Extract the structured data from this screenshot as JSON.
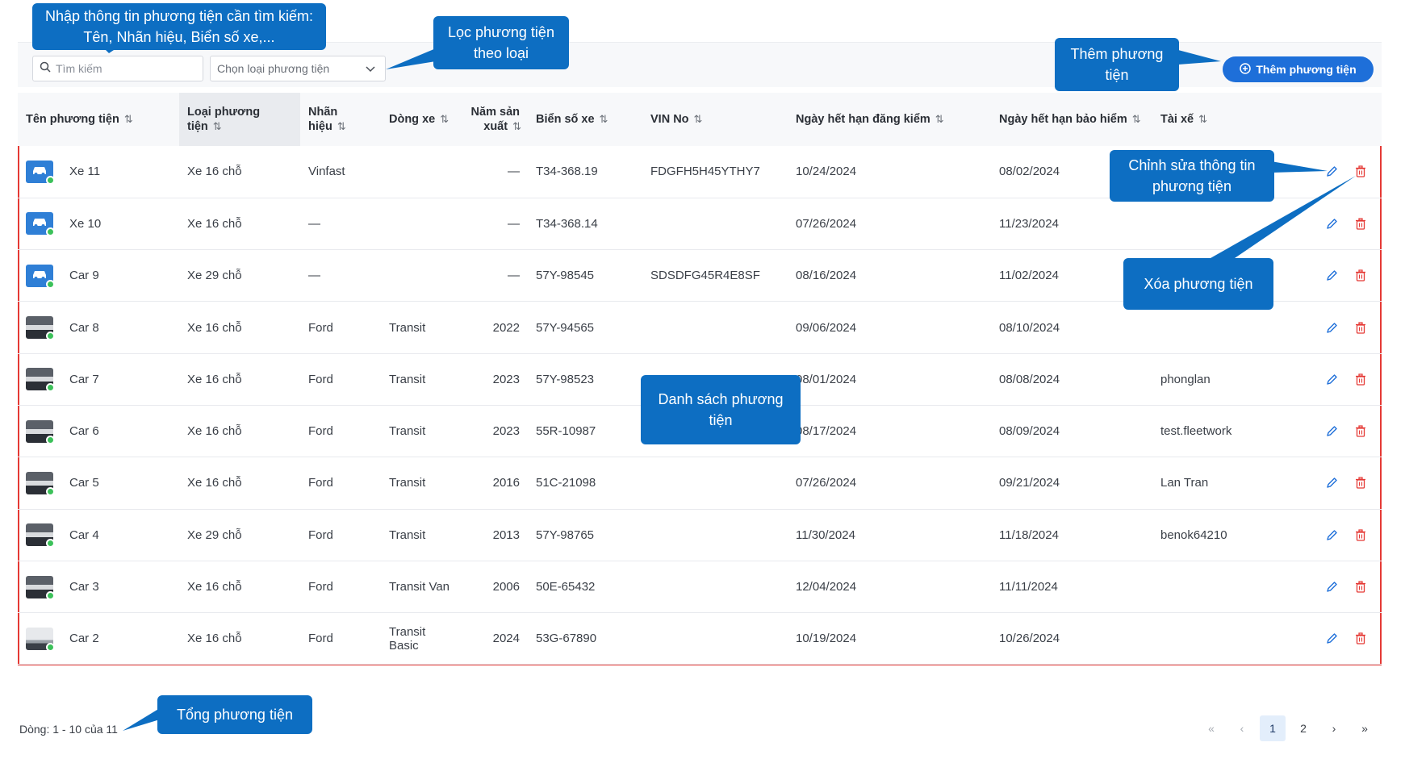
{
  "toolbar": {
    "search_placeholder": "Tìm kiếm",
    "type_select_placeholder": "Chọn loại phương tiện",
    "add_button_label": "Thêm phương tiện"
  },
  "table": {
    "columns": [
      {
        "label": "Tên phương tiện",
        "sortable": true
      },
      {
        "label": "Loại phương tiện",
        "sortable": true
      },
      {
        "label": "Nhãn hiệu",
        "sortable": true
      },
      {
        "label": "Dòng xe",
        "sortable": true
      },
      {
        "label": "Năm sản xuất",
        "sortable": true
      },
      {
        "label": "Biển số xe",
        "sortable": true
      },
      {
        "label": "VIN No",
        "sortable": true
      },
      {
        "label": "Ngày hết hạn đăng kiểm",
        "sortable": true
      },
      {
        "label": "Ngày hết hạn bảo hiểm",
        "sortable": true
      },
      {
        "label": "Tài xế",
        "sortable": true
      }
    ],
    "sort_icon": "⇅",
    "rows": [
      {
        "thumb": "blue-car",
        "name": "Xe 11",
        "type": "Xe 16 chỗ",
        "brand": "Vinfast",
        "model": "",
        "year": "—",
        "plate": "T34-368.19",
        "vin": "FDGFH5H45YTHY7",
        "inspection": "10/24/2024",
        "insurance": "08/02/2024",
        "driver": ""
      },
      {
        "thumb": "blue-car",
        "name": "Xe 10",
        "type": "Xe 16 chỗ",
        "brand": "—",
        "model": "",
        "year": "—",
        "plate": "T34-368.14",
        "vin": "",
        "inspection": "07/26/2024",
        "insurance": "11/23/2024",
        "driver": ""
      },
      {
        "thumb": "blue-car",
        "name": "Car 9",
        "type": "Xe 29 chỗ",
        "brand": "—",
        "model": "",
        "year": "—",
        "plate": "57Y-98545",
        "vin": "SDSDFG45R4E8SF",
        "inspection": "08/16/2024",
        "insurance": "11/02/2024",
        "driver": ""
      },
      {
        "thumb": "van",
        "name": "Car 8",
        "type": "Xe 16 chỗ",
        "brand": "Ford",
        "model": "Transit",
        "year": "2022",
        "plate": "57Y-94565",
        "vin": "",
        "inspection": "09/06/2024",
        "insurance": "08/10/2024",
        "driver": ""
      },
      {
        "thumb": "van",
        "name": "Car 7",
        "type": "Xe 16 chỗ",
        "brand": "Ford",
        "model": "Transit",
        "year": "2023",
        "plate": "57Y-98523",
        "vin": "",
        "inspection": "08/01/2024",
        "insurance": "08/08/2024",
        "driver": "phonglan"
      },
      {
        "thumb": "van",
        "name": "Car 6",
        "type": "Xe 16 chỗ",
        "brand": "Ford",
        "model": "Transit",
        "year": "2023",
        "plate": "55R-10987",
        "vin": "",
        "inspection": "08/17/2024",
        "insurance": "08/09/2024",
        "driver": "test.fleetwork"
      },
      {
        "thumb": "van",
        "name": "Car 5",
        "type": "Xe 16 chỗ",
        "brand": "Ford",
        "model": "Transit",
        "year": "2016",
        "plate": "51C-21098",
        "vin": "",
        "inspection": "07/26/2024",
        "insurance": "09/21/2024",
        "driver": "Lan Tran"
      },
      {
        "thumb": "van",
        "name": "Car 4",
        "type": "Xe 29 chỗ",
        "brand": "Ford",
        "model": "Transit",
        "year": "2013",
        "plate": "57Y-98765",
        "vin": "",
        "inspection": "11/30/2024",
        "insurance": "11/18/2024",
        "driver": "benok64210"
      },
      {
        "thumb": "van",
        "name": "Car 3",
        "type": "Xe 16 chỗ",
        "brand": "Ford",
        "model": "Transit Van",
        "year": "2006",
        "plate": "50E-65432",
        "vin": "",
        "inspection": "12/04/2024",
        "insurance": "11/11/2024",
        "driver": ""
      },
      {
        "thumb": "van-white",
        "name": "Car 2",
        "type": "Xe 16 chỗ",
        "brand": "Ford",
        "model": "Transit Basic",
        "year": "2024",
        "plate": "53G-67890",
        "vin": "",
        "inspection": "10/19/2024",
        "insurance": "10/26/2024",
        "driver": ""
      }
    ]
  },
  "footer": {
    "row_count": "Dòng: 1 - 10 của 11",
    "pager": {
      "first": "«",
      "prev": "‹",
      "pages": [
        "1",
        "2"
      ],
      "current": "1",
      "next": "›",
      "last": "»"
    }
  },
  "callouts": {
    "search_hint": "Nhập thông tin phương tiện cần tìm kiếm: Tên, Nhãn hiệu, Biển số xe,...",
    "filter_hint": "Lọc phương tiện theo loại",
    "add_hint": "Thêm phương tiện",
    "edit_hint": "Chỉnh sửa thông tin phương tiện",
    "delete_hint": "Xóa phương tiện",
    "list_hint": "Danh sách phương tiện",
    "total_hint": "Tổng phương tiện"
  },
  "colors": {
    "accent": "#1e6fd9",
    "callout": "#0d6ec2",
    "highlight_border": "#e53935",
    "delete_icon": "#e53935",
    "edit_icon": "#1e6fd9",
    "status_dot": "#3cc15a"
  },
  "icons": {
    "search": "search-icon",
    "dropdown": "chevron-down-icon",
    "add": "plus-circle-icon",
    "edit": "pencil-icon",
    "delete": "trash-icon",
    "status": "online-dot-icon"
  }
}
